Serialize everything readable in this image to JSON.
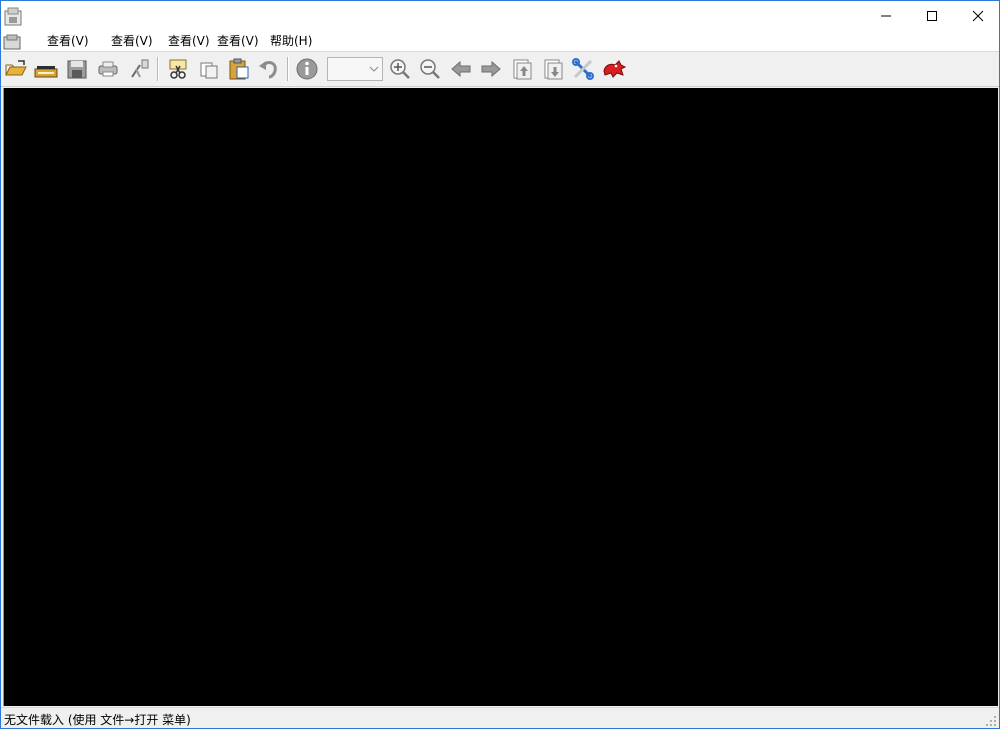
{
  "window": {
    "controls": {
      "minimize_icon": "minimize-icon",
      "maximize_icon": "maximize-icon",
      "close_icon": "close-icon"
    }
  },
  "menu": {
    "items": [
      {
        "label": "查看(V)",
        "x_hint": "first"
      },
      {
        "label": "查看(V)"
      },
      {
        "label": "查看(V)"
      },
      {
        "label": "查看(V)"
      },
      {
        "label": "帮助(H)"
      }
    ]
  },
  "toolbar": {
    "buttons": [
      "open-icon",
      "scan-icon",
      "save-icon",
      "print-icon",
      "tools-icon",
      "cut-icon",
      "copy-icon",
      "paste-icon",
      "undo-icon",
      "info-icon",
      "zoom-in-icon",
      "zoom-out-icon",
      "back-icon",
      "forward-icon",
      "page-up-icon",
      "page-down-icon",
      "settings-icon",
      "exit-icon"
    ],
    "zoom_value": ""
  },
  "status": {
    "text": "无文件载入 (使用 文件→打开 菜单)"
  },
  "colors": {
    "accent": "#2b79d7",
    "canvas": "#000000",
    "chrome": "#f0f0f0"
  }
}
